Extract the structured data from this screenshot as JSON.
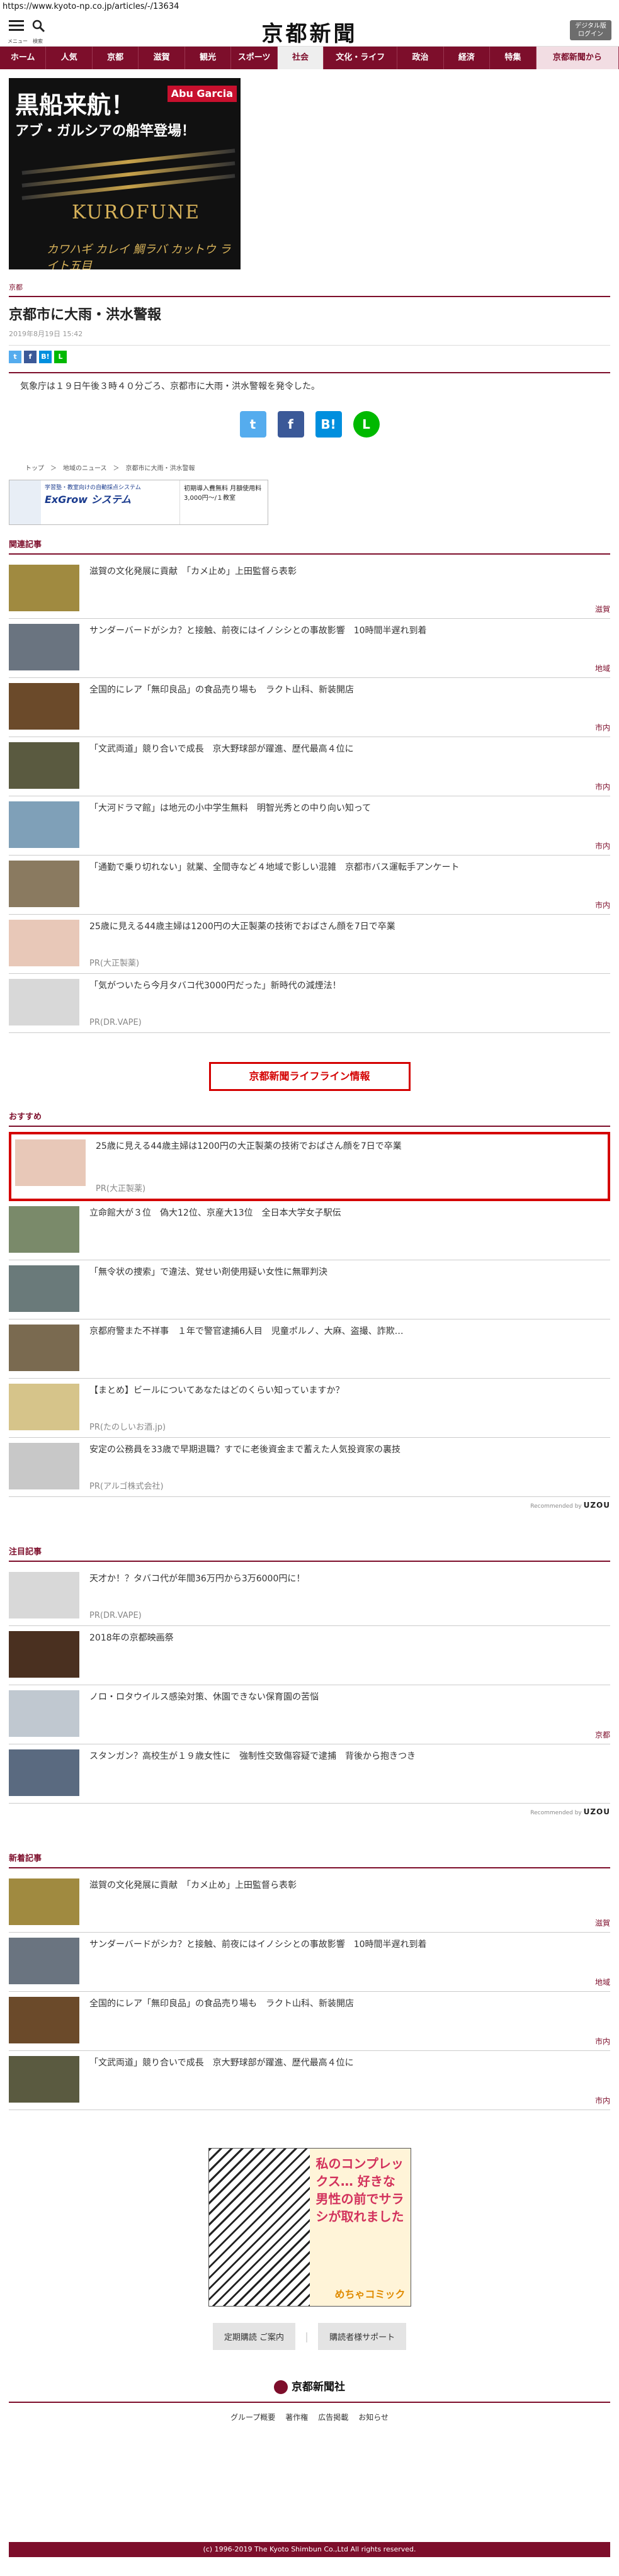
{
  "url": "https://www.kyoto-np.co.jp/articles/-/13634",
  "header": {
    "menu_label": "メニュー",
    "search_label": "検索",
    "logo": "京都新聞",
    "digital_line1": "デジタル版",
    "digital_line2": "ログイン"
  },
  "nav": [
    "ホーム",
    "人気",
    "京都",
    "滋賀",
    "観光",
    "スポーツ",
    "社会",
    "文化・ライフ",
    "政治",
    "経済",
    "特集",
    "京都新聞から"
  ],
  "ad_top": {
    "line1": "黒船来航！",
    "line2": "アブ・ガルシアの船竿登場！",
    "brand": "Abu Garcia",
    "product": "KUROFUNE",
    "sub": "カワハギ カレイ 鯛ラバ カットウ ライト五目"
  },
  "article": {
    "category": "京都",
    "title": "京都市に大雨・洪水警報",
    "date": "2019年8月19日 15:42",
    "body": "気象庁は１９日午後３時４０分ごろ、京都市に大雨・洪水警報を発令した。",
    "share": [
      "t",
      "f",
      "B!",
      "L"
    ]
  },
  "breadcrumb": [
    "トップ",
    "＞",
    "地域のニュース",
    "＞",
    "京都市に大雨・洪水警報"
  ],
  "ad_mid": {
    "left_small": "学習塾・教室向けの自動採点システム",
    "name": "ExGrow システム",
    "right": "初期導入費無料 月額使用料 3,000円～/１教室"
  },
  "related": {
    "heading": "関連記事",
    "items": [
      {
        "title": "滋賀の文化発展に貢献　「カメ止め」上田監督ら表彰",
        "tag": "滋賀",
        "thumb": "#a08a40"
      },
      {
        "title": "サンダーバードがシカ？と接触、前夜にはイノシシとの事故影響　10時間半遅れ到着",
        "tag": "地域",
        "thumb": "#6a7480"
      },
      {
        "title": "全国的にレア「無印良品」の食品売り場も　ラクト山科、新装開店",
        "tag": "市内",
        "thumb": "#6b4a2a"
      },
      {
        "title": "「文武両道」競り合いで成長　京大野球部が躍進、歴代最高４位に",
        "tag": "市内",
        "thumb": "#5a5a40"
      },
      {
        "title": "「大河ドラマ館」は地元の小中学生無料　明智光秀との中り向い知って",
        "tag": "市内",
        "thumb": "#7fa0b8"
      },
      {
        "title": "「通勤で乗り切れない」就業、全間寺など４地域で影しい混雑　京都市バス運転手アンケート",
        "tag": "市内",
        "thumb": "#8a7a60"
      },
      {
        "title": "25歳に見える44歳主婦は1200円の大正製薬の技術でおばさん顔を7日で卒業",
        "tag": "PR(大正製薬)",
        "thumb": "#e8c8b8",
        "pr": true
      },
      {
        "title": "「気がついたら今月タバコ代3000円だった」新時代の減煙法！",
        "tag": "PR(DR.VAPE)",
        "thumb": "#d8d8d8",
        "pr": true
      }
    ]
  },
  "lifeline": "京都新聞ライフライン情報",
  "recommend": {
    "heading": "おすすめ",
    "items": [
      {
        "title": "25歳に見える44歳主婦は1200円の大正製薬の技術でおばさん顔を7日で卒業",
        "tag": "PR(大正製薬)",
        "thumb": "#e8c8b8",
        "pr": true,
        "highlight": true
      },
      {
        "title": "立命館大が３位　偽大12位、京産大13位　全日本大学女子駅伝",
        "tag": "",
        "thumb": "#7a8a6a"
      },
      {
        "title": "「無令状の捜索」で違法、覚せい剤使用疑い女性に無罪判決",
        "tag": "",
        "thumb": "#6a7a7a"
      },
      {
        "title": "京都府警また不祥事　１年で警官逮捕6人目　児童ポルノ、大麻、盗撮、詐欺…",
        "tag": "",
        "thumb": "#7a6a50"
      },
      {
        "title": "【まとめ】ビールについてあなたはどのくらい知っていますか？",
        "tag": "PR(たのしいお酒.jp)",
        "thumb": "#d6c48a",
        "pr": true
      },
      {
        "title": "安定の公務員を33歳で早期退職？すでに老後資金まで蓄えた人気投資家の裏技",
        "tag": "PR(アルゴ株式会社)",
        "thumb": "#c8c8c8",
        "pr": true
      }
    ],
    "recommended_by": "Recommended by",
    "uzou": "UZOU"
  },
  "notable": {
    "heading": "注目記事",
    "items": [
      {
        "title": "天才か！？タバコ代が年間36万円から3万6000円に！",
        "tag": "PR(DR.VAPE)",
        "thumb": "#d8d8d8",
        "pr": true
      },
      {
        "title": "2018年の京都映画祭",
        "tag": "",
        "thumb": "#4a3020"
      },
      {
        "title": "ノロ・ロタウイルス感染対策、休園できない保育園の苦悩",
        "tag": "京都",
        "thumb": "#c0c8d0"
      },
      {
        "title": "スタンガン？高校生が１９歳女性に　強制性交致傷容疑で逮捕　背後から抱きつき",
        "tag": "",
        "thumb": "#5a6a80"
      }
    ],
    "recommended_by": "Recommended by",
    "uzou": "UZOU"
  },
  "latest": {
    "heading": "新着記事",
    "items": [
      {
        "title": "滋賀の文化発展に貢献　「カメ止め」上田監督ら表彰",
        "tag": "滋賀",
        "thumb": "#a08a40"
      },
      {
        "title": "サンダーバードがシカ？と接触、前夜にはイノシシとの事故影響　10時間半遅れ到着",
        "tag": "地域",
        "thumb": "#6a7480"
      },
      {
        "title": "全国的にレア「無印良品」の食品売り場も　ラクト山科、新装開店",
        "tag": "市内",
        "thumb": "#6b4a2a"
      },
      {
        "title": "「文武両道」競り合いで成長　京大野球部が躍進、歴代最高４位に",
        "tag": "市内",
        "thumb": "#5a5a40"
      }
    ]
  },
  "ad_manga": {
    "text": "私のコンプレックス… 好きな男性の前でサラシが取れました",
    "brand": "めちゃコミック"
  },
  "help": {
    "btn1": "定期購読 ご案内",
    "sep": "｜",
    "btn2": "購読者様サポート"
  },
  "footer": {
    "logo": "京都新聞社",
    "links": [
      "グループ概要",
      "著作権",
      "広告掲載",
      "お知らせ"
    ],
    "copyright": "(c) 1996-2019 The Kyoto Shimbun Co.,Ltd All rights reserved."
  },
  "colors": {
    "brand": "#7d0e2b",
    "highlight": "#d40000",
    "twitter": "#55acee",
    "facebook": "#3b5998",
    "hatena": "#008fde",
    "line": "#00b900"
  }
}
